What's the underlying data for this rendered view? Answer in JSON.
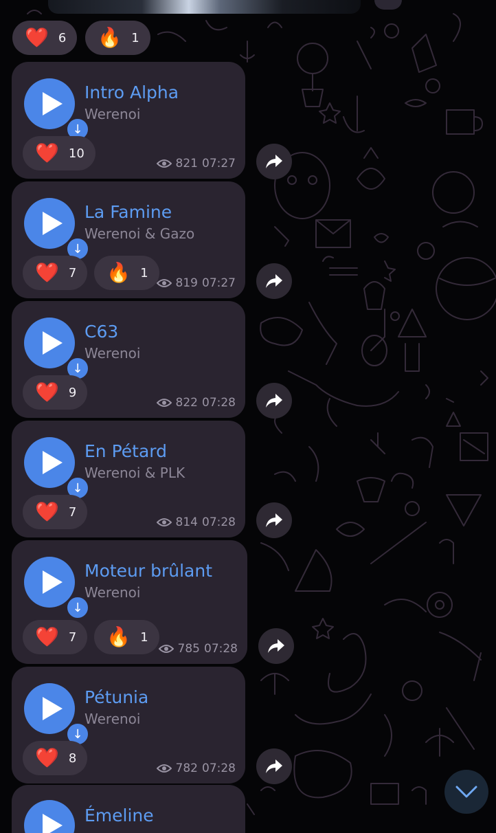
{
  "top_reactions": [
    {
      "emoji": "❤️",
      "kind": "heart",
      "count": "6"
    },
    {
      "emoji": "🔥",
      "kind": "fire",
      "count": "1"
    }
  ],
  "messages": [
    {
      "title": "Intro Alpha",
      "artist": "Werenoi",
      "reactions": [
        {
          "emoji": "❤️",
          "kind": "heart",
          "count": "10"
        }
      ],
      "views": "821",
      "time": "07:27"
    },
    {
      "title": "La Famine",
      "artist": "Werenoi & Gazo",
      "reactions": [
        {
          "emoji": "❤️",
          "kind": "heart",
          "count": "7"
        },
        {
          "emoji": "🔥",
          "kind": "fire",
          "count": "1"
        }
      ],
      "views": "819",
      "time": "07:27"
    },
    {
      "title": "C63",
      "artist": "Werenoi",
      "reactions": [
        {
          "emoji": "❤️",
          "kind": "heart",
          "count": "9"
        }
      ],
      "views": "822",
      "time": "07:28"
    },
    {
      "title": "En Pétard",
      "artist": "Werenoi & PLK",
      "reactions": [
        {
          "emoji": "❤️",
          "kind": "heart",
          "count": "7"
        }
      ],
      "views": "814",
      "time": "07:28"
    },
    {
      "title": "Moteur brûlant",
      "artist": "Werenoi",
      "reactions": [
        {
          "emoji": "❤️",
          "kind": "heart",
          "count": "7"
        },
        {
          "emoji": "🔥",
          "kind": "fire",
          "count": "1"
        }
      ],
      "views": "785",
      "time": "07:28"
    },
    {
      "title": "Pétunia",
      "artist": "Werenoi",
      "reactions": [
        {
          "emoji": "❤️",
          "kind": "heart",
          "count": "8"
        }
      ],
      "views": "782",
      "time": "07:28"
    }
  ],
  "partial_message": {
    "title": "Émeline"
  },
  "icons": {
    "play": "play-icon",
    "download": "download-arrow-icon",
    "views": "eye-icon",
    "forward": "share-forward-icon",
    "scroll": "chevron-down-icon"
  },
  "colors": {
    "accent": "#5d9cf2",
    "play_button": "#4b86e8",
    "bubble": "#2a2430",
    "reaction_pill": "#3b3441",
    "background": "#050507"
  }
}
